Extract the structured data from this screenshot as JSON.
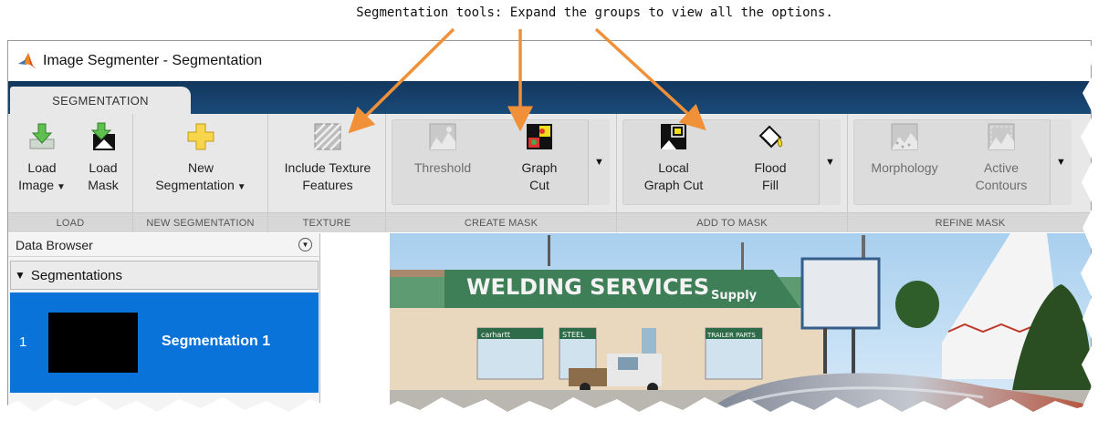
{
  "annotation": "Segmentation tools: Expand the groups to view all the options.",
  "window": {
    "title": "Image Segmenter - Segmentation",
    "tab": "SEGMENTATION"
  },
  "toolstrip": {
    "load": {
      "group_label": "LOAD",
      "load_image": [
        "Load",
        "Image"
      ],
      "load_mask": [
        "Load",
        "Mask"
      ]
    },
    "new_segmentation": {
      "group_label": "NEW SEGMENTATION",
      "button": [
        "New",
        "Segmentation"
      ]
    },
    "texture": {
      "group_label": "TEXTURE",
      "button": [
        "Include Texture",
        "Features"
      ]
    },
    "create_mask": {
      "group_label": "CREATE MASK",
      "threshold": "Threshold",
      "graph_cut": [
        "Graph",
        "Cut"
      ]
    },
    "add_to_mask": {
      "group_label": "ADD TO MASK",
      "local_graph_cut": [
        "Local",
        "Graph Cut"
      ],
      "flood_fill": [
        "Flood",
        "Fill"
      ]
    },
    "refine_mask": {
      "group_label": "REFINE MASK",
      "morphology": "Morphology",
      "active_contours": [
        "Active",
        "Contours"
      ]
    }
  },
  "data_browser": {
    "title": "Data Browser",
    "section": "Segmentations",
    "items": [
      {
        "index": "1",
        "name": "Segmentation 1"
      }
    ]
  },
  "image": {
    "sign_text": "WELDING SERVICES",
    "sign_small": "Supply",
    "store_labels": [
      "carhartt",
      "STEEL",
      "TRAILER PARTS"
    ]
  },
  "colors": {
    "arrow": "#f0913a",
    "tab_strip": "#163f6b",
    "toolstrip": "#e8e8e8",
    "selection": "#0a73d9"
  }
}
